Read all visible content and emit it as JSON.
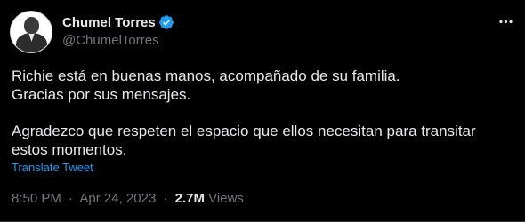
{
  "user": {
    "display_name": "Chumel Torres",
    "handle": "@ChumelTorres",
    "verified": true
  },
  "tweet": {
    "lines_p1": [
      "Richie está en buenas manos, acompañado de su familia.",
      "Gracias por sus mensajes."
    ],
    "p2": "Agradezco que respeten el espacio que ellos necesitan para transitar estos momentos.",
    "translate_label": "Translate Tweet",
    "time": "8:50 PM",
    "date": "Apr 24, 2023",
    "views_count": "2.7M",
    "views_label": "Views",
    "separator": "·"
  },
  "colors": {
    "background": "#000000",
    "text": "#e7e9ea",
    "muted": "#71767b",
    "accent": "#1d9bf0"
  },
  "icons": {
    "verified": "verified-badge-icon",
    "more": "more-options-icon"
  }
}
